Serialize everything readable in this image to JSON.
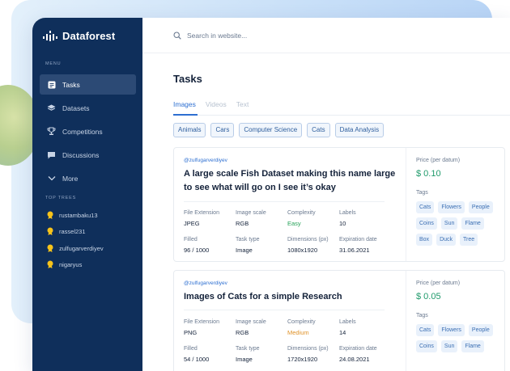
{
  "brand": {
    "name": "Dataforest"
  },
  "sidebar": {
    "menu_heading": "MENU",
    "items": [
      {
        "label": "Tasks",
        "icon": "tasks-icon",
        "active": true
      },
      {
        "label": "Datasets",
        "icon": "layers-icon",
        "active": false
      },
      {
        "label": "Competitions",
        "icon": "trophy-icon",
        "active": false
      },
      {
        "label": "Discussions",
        "icon": "chat-icon",
        "active": false
      },
      {
        "label": "More",
        "icon": "chevron-down-icon",
        "active": false
      }
    ],
    "top_trees_heading": "TOP TREES",
    "top_trees": [
      "rustambaku13",
      "rassel231",
      "zulfugarverdiyev",
      "nigaryus"
    ]
  },
  "search": {
    "placeholder": "Search in website..."
  },
  "page": {
    "title": "Tasks"
  },
  "tabs": [
    {
      "label": "Images",
      "active": true
    },
    {
      "label": "Videos",
      "active": false
    },
    {
      "label": "Text",
      "active": false
    }
  ],
  "filters": [
    "Animals",
    "Cars",
    "Computer Science",
    "Cats",
    "Data Analysis"
  ],
  "cards": [
    {
      "author": "@zulfugarverdiyev",
      "title": "A large scale Fish Dataset making this name large to see what will go on I see it’s okay",
      "file_extension_label": "File Extension",
      "file_extension": "JPEG",
      "image_scale_label": "Image scale",
      "image_scale": "RGB",
      "complexity_label": "Complexity",
      "complexity": "Easy",
      "labels_label": "Labels",
      "labels": "10",
      "filled_label": "Filled",
      "filled": "96 / 1000",
      "task_type_label": "Task type",
      "task_type": "Image",
      "dimensions_label": "Dimensions (px)",
      "dimensions": "1080x1920",
      "expiration_label": "Expiration date",
      "expiration": "31.06.2021",
      "price_label": "Price (per datum)",
      "price": "$ 0.10",
      "tags_label": "Tags",
      "tags": [
        "Cats",
        "Flowers",
        "People",
        "Coins",
        "Sun",
        "Flame",
        "Box",
        "Duck",
        "Tree"
      ]
    },
    {
      "author": "@zulfugarverdiyev",
      "title": "Images of Cats for a simple Research",
      "file_extension_label": "File Extension",
      "file_extension": "PNG",
      "image_scale_label": "Image scale",
      "image_scale": "RGB",
      "complexity_label": "Complexity",
      "complexity": "Medium",
      "labels_label": "Labels",
      "labels": "14",
      "filled_label": "Filled",
      "filled": "54 / 1000",
      "task_type_label": "Task type",
      "task_type": "Image",
      "dimensions_label": "Dimensions (px)",
      "dimensions": "1720x1920",
      "expiration_label": "Expiration date",
      "expiration": "24.08.2021",
      "price_label": "Price (per datum)",
      "price": "$ 0.05",
      "tags_label": "Tags",
      "tags": [
        "Cats",
        "Flowers",
        "People",
        "Coins",
        "Sun",
        "Flame"
      ]
    }
  ]
}
